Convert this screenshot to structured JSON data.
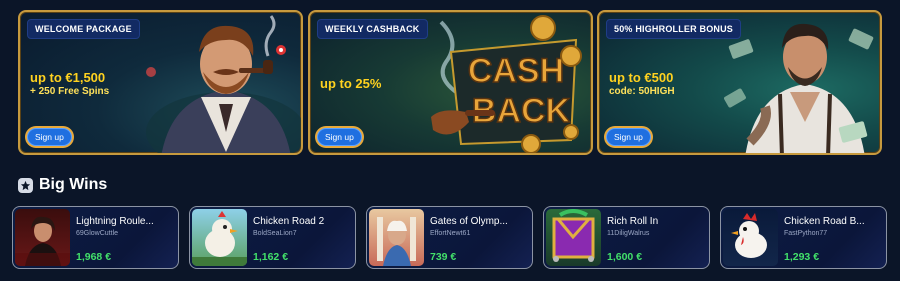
{
  "promos": [
    {
      "badge": "WELCOME PACKAGE",
      "amount": "up to €1,500",
      "sub": "+ 250 Free Spins",
      "cta": "Sign up"
    },
    {
      "badge": "WEEKLY CASHBACK",
      "amount": "up to 25%",
      "sub": "",
      "cta": "Sign up",
      "art_text": [
        "CASH",
        "BACK"
      ]
    },
    {
      "badge": "50% HIGHROLLER BONUS",
      "amount": "up to €500",
      "sub": "code: 50HIGH",
      "cta": "Sign up"
    }
  ],
  "big_wins": {
    "title": "Big Wins",
    "icon": "star-icon",
    "items": [
      {
        "game": "Lightning Roule...",
        "user": "69GlowCuttle",
        "amount": "1,968 €"
      },
      {
        "game": "Chicken Road 2",
        "user": "BoldSeaLion7",
        "amount": "1,162 €"
      },
      {
        "game": "Gates of Olymp...",
        "user": "EffortNewt61",
        "amount": "739 €"
      },
      {
        "game": "Rich Roll In",
        "user": "11DiligWalrus",
        "amount": "1,600 €"
      },
      {
        "game": "Chicken Road B...",
        "user": "FastPython77",
        "amount": "1,293 €"
      }
    ]
  },
  "colors": {
    "background": "#0b1528",
    "accent_gold": "#ffd21f",
    "win_green": "#42e06a",
    "button_blue": "#1f6fe0"
  }
}
